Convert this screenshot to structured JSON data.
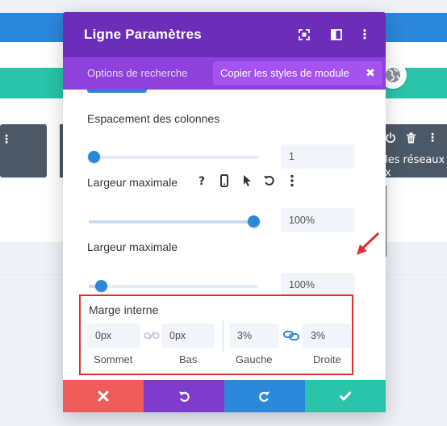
{
  "background": {
    "right_module_text_line1": "les réseaux",
    "right_module_text_line2": "x",
    "left_module_icon": "more-vertical-icon",
    "right_module_icons": [
      "power-icon",
      "trash-icon",
      "more-vertical-icon"
    ],
    "globe_icon": "globe-icon"
  },
  "modal": {
    "title": "Ligne Paramètres",
    "header_icons": [
      "fullscreen-icon",
      "sidebar-toggle-icon",
      "more-vertical-icon"
    ],
    "tabs": {
      "search_label": "Options de recherche",
      "copy_styles_label": "Copier les styles de module",
      "close_glyph": "✖"
    },
    "fields": [
      {
        "label": "Espacement des colonnes",
        "value": "1",
        "slider_fraction": 0.03
      },
      {
        "label": "Largeur maximale",
        "value": "100%",
        "slider_fraction": 0.97,
        "tools": [
          "help-icon",
          "mobile-icon",
          "cursor-icon",
          "reset-icon",
          "more-vertical-icon"
        ]
      },
      {
        "label": "Largeur maximale",
        "value": "100%",
        "slider_fraction": 0.07
      }
    ],
    "padding": {
      "title": "Marge interne",
      "top": {
        "value": "0px",
        "caption": "Sommet"
      },
      "bottom": {
        "value": "0px",
        "caption": "Bas"
      },
      "left": {
        "value": "3%",
        "caption": "Gauche"
      },
      "right": {
        "value": "3%",
        "caption": "Droite"
      },
      "top_bottom_linked": false,
      "left_right_linked": true
    },
    "footer_buttons": [
      {
        "name": "cancel",
        "icon": "close-icon",
        "color": "#ef5a5a"
      },
      {
        "name": "undo",
        "icon": "undo-icon",
        "color": "#7f3ccc"
      },
      {
        "name": "redo",
        "icon": "redo-icon",
        "color": "#2b87da"
      },
      {
        "name": "save",
        "icon": "check-icon",
        "color": "#29c4a9"
      }
    ]
  },
  "colors": {
    "header_purple": "#6c2eb9",
    "tabs_purple": "#8e42dc",
    "pill_purple": "#a552ef",
    "accent_blue": "#2b87da",
    "highlight_red": "#e12f2f"
  }
}
